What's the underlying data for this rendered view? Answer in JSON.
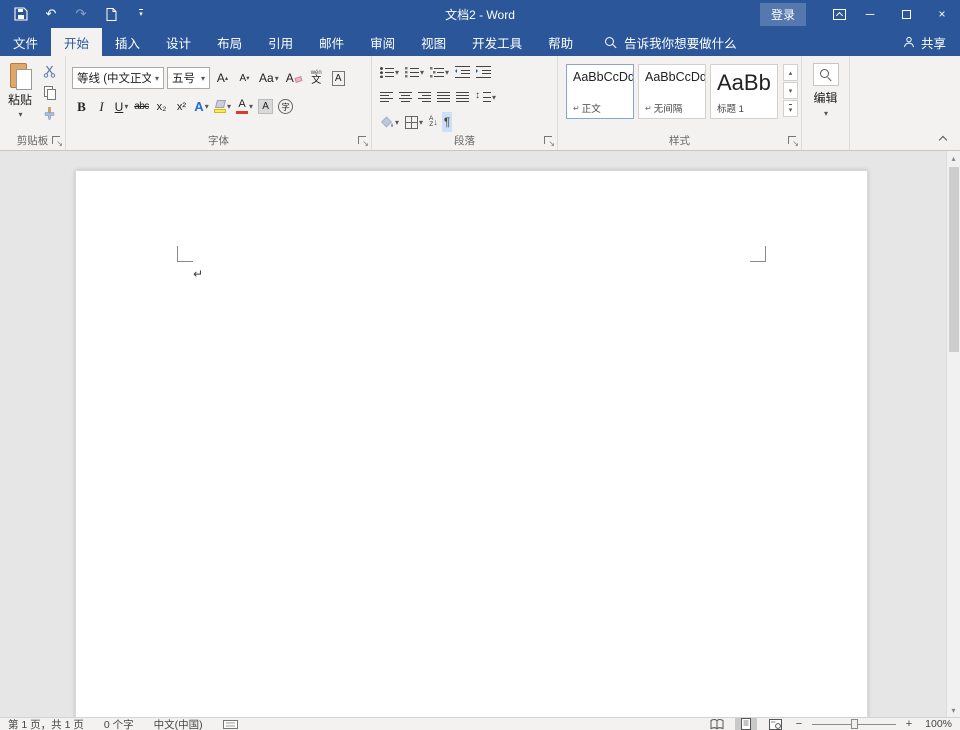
{
  "titlebar": {
    "title": "文档2 - Word",
    "sign_in": "登录"
  },
  "tabs": [
    "文件",
    "开始",
    "插入",
    "设计",
    "布局",
    "引用",
    "邮件",
    "审阅",
    "视图",
    "开发工具",
    "帮助"
  ],
  "tellme": "告诉我你想要做什么",
  "share": "共享",
  "clipboard": {
    "label": "剪贴板",
    "paste": "粘贴"
  },
  "font": {
    "label": "字体",
    "name": "等线 (中文正文",
    "size": "五号",
    "grow": "A",
    "shrink": "A",
    "case": "Aa",
    "clear": "A",
    "phonetic_top": "wén",
    "phonetic_bottom": "文",
    "char_border": "A",
    "bold": "B",
    "italic": "I",
    "underline": "U",
    "strikethrough": "abc",
    "subscript": "x₂",
    "superscript": "x²",
    "text_effects": "A",
    "font_color": "A",
    "char_shading": "A",
    "enclose": "字"
  },
  "paragraph": {
    "label": "段落",
    "sort_a": "A",
    "sort_z": "Z"
  },
  "styles": {
    "label": "样式",
    "items": [
      {
        "preview": "AaBbCcDd",
        "marker": "↵",
        "name": "正文"
      },
      {
        "preview": "AaBbCcDd",
        "marker": "↵",
        "name": "无间隔"
      },
      {
        "preview": "AaBb",
        "marker": "",
        "name": "标题 1"
      }
    ]
  },
  "editing": {
    "label": "编辑"
  },
  "document": {
    "paragraph_mark": "↵"
  },
  "statusbar": {
    "page_info": "第 1 页，共 1 页",
    "word_count": "0 个字",
    "language": "中文(中国)",
    "zoom": "100%"
  },
  "glyphs": {
    "caret_down": "▾",
    "caret_up": "▴",
    "undo": "↶",
    "redo": "↷",
    "minimize": "─",
    "close": "×",
    "pilcrow": "¶",
    "sort_arrow": "↓",
    "zoom_out": "−",
    "zoom_in": "+"
  },
  "colors": {
    "accent": "#2b579a",
    "highlight_yellow": "#ffef3e",
    "font_color_red": "#d83b2d",
    "clipboard_brown": "#e0a868"
  }
}
